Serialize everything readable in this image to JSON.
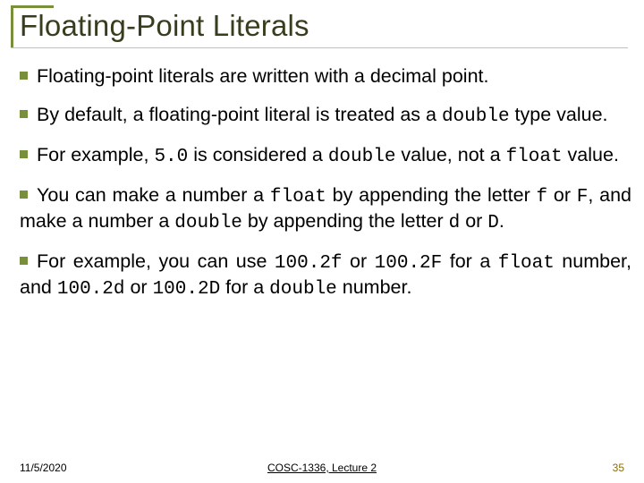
{
  "title": "Floating-Point Literals",
  "bullets": {
    "b1": "Floating-point literals are written with a decimal point.",
    "b2a": "By default, a floating-point literal is treated as a ",
    "b2_code": "double",
    "b2b": " type value.",
    "b3a": "For example, ",
    "b3_code1": "5.0",
    "b3b": " is considered a ",
    "b3_code2": "double",
    "b3c": " value, not a ",
    "b3_code3": "float",
    "b3d": " value.",
    "b4a": "You can make a number a ",
    "b4_code1": "float",
    "b4b": " by appending the letter ",
    "b4_code2": "f",
    "b4c": " or ",
    "b4_code3": "F",
    "b4d": ", and make a number a ",
    "b4_code4": "double",
    "b4e": " by appending the letter ",
    "b4_code5": "d",
    "b4f": " or ",
    "b4_code6": "D",
    "b4g": ".",
    "b5a": "For example, you can use ",
    "b5_code1": "100.2f",
    "b5b": " or ",
    "b5_code2": "100.2F",
    "b5c": " for a ",
    "b5_code3": "float",
    "b5d": " number, and ",
    "b5_code4": "100.2d",
    "b5e": " or ",
    "b5_code5": "100.2D",
    "b5f": " for a ",
    "b5_code6": "double",
    "b5g": " number."
  },
  "footer": {
    "date": "11/5/2020",
    "course": "COSC-1336, Lecture 2",
    "page": "35"
  }
}
